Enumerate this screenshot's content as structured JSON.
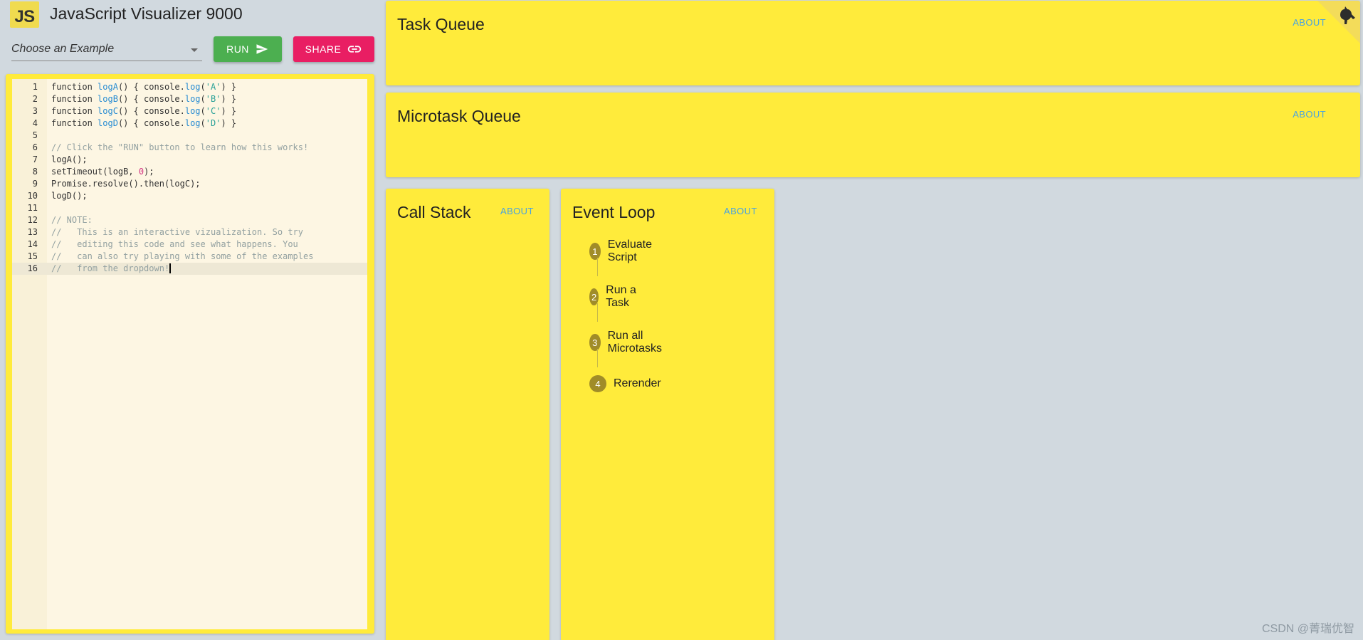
{
  "header": {
    "logo_text": "JS",
    "app_title": "JavaScript Visualizer 9000",
    "example_select_placeholder": "Choose an Example",
    "run_label": "RUN",
    "share_label": "SHARE"
  },
  "editor": {
    "lines": [
      {
        "n": "1",
        "html_tokens": [
          [
            "",
            "function "
          ],
          [
            "fn",
            "logA"
          ],
          [
            "",
            "() { console."
          ],
          [
            "fn",
            "log"
          ],
          [
            "",
            "("
          ],
          [
            "str",
            "'A'"
          ],
          [
            "",
            ") }"
          ]
        ]
      },
      {
        "n": "2",
        "html_tokens": [
          [
            "",
            "function "
          ],
          [
            "fn",
            "logB"
          ],
          [
            "",
            "() { console."
          ],
          [
            "fn",
            "log"
          ],
          [
            "",
            "("
          ],
          [
            "str",
            "'B'"
          ],
          [
            "",
            ") }"
          ]
        ]
      },
      {
        "n": "3",
        "html_tokens": [
          [
            "",
            "function "
          ],
          [
            "fn",
            "logC"
          ],
          [
            "",
            "() { console."
          ],
          [
            "fn",
            "log"
          ],
          [
            "",
            "("
          ],
          [
            "str",
            "'C'"
          ],
          [
            "",
            ") }"
          ]
        ]
      },
      {
        "n": "4",
        "html_tokens": [
          [
            "",
            "function "
          ],
          [
            "fn",
            "logD"
          ],
          [
            "",
            "() { console."
          ],
          [
            "fn",
            "log"
          ],
          [
            "",
            "("
          ],
          [
            "str",
            "'D'"
          ],
          [
            "",
            ") }"
          ]
        ]
      },
      {
        "n": "5",
        "html_tokens": []
      },
      {
        "n": "6",
        "html_tokens": [
          [
            "cm",
            "// Click the \"RUN\" button to learn how this works!"
          ]
        ]
      },
      {
        "n": "7",
        "html_tokens": [
          [
            "",
            "logA();"
          ]
        ]
      },
      {
        "n": "8",
        "html_tokens": [
          [
            "",
            "setTimeout(logB, "
          ],
          [
            "num",
            "0"
          ],
          [
            "",
            ");"
          ]
        ]
      },
      {
        "n": "9",
        "html_tokens": [
          [
            "",
            "Promise.resolve().then(logC);"
          ]
        ]
      },
      {
        "n": "10",
        "html_tokens": [
          [
            "",
            "logD();"
          ]
        ]
      },
      {
        "n": "11",
        "html_tokens": []
      },
      {
        "n": "12",
        "html_tokens": [
          [
            "cm",
            "// NOTE:"
          ]
        ]
      },
      {
        "n": "13",
        "html_tokens": [
          [
            "cm",
            "//   This is an interactive vizualization. So try"
          ]
        ]
      },
      {
        "n": "14",
        "html_tokens": [
          [
            "cm",
            "//   editing this code and see what happens. You"
          ]
        ]
      },
      {
        "n": "15",
        "html_tokens": [
          [
            "cm",
            "//   can also try playing with some of the examples"
          ]
        ]
      },
      {
        "n": "16",
        "html_tokens": [
          [
            "cm",
            "//   from the dropdown!"
          ]
        ],
        "active": true
      }
    ]
  },
  "panels": {
    "task_queue": {
      "title": "Task Queue",
      "about": "ABOUT"
    },
    "microtask_queue": {
      "title": "Microtask Queue",
      "about": "ABOUT"
    },
    "call_stack": {
      "title": "Call Stack",
      "about": "ABOUT"
    },
    "event_loop": {
      "title": "Event Loop",
      "about": "ABOUT",
      "steps": [
        {
          "num": "1",
          "label": "Evaluate Script"
        },
        {
          "num": "2",
          "label": "Run a Task"
        },
        {
          "num": "3",
          "label": "Run all Microtasks"
        },
        {
          "num": "4",
          "label": "Rerender"
        }
      ]
    }
  },
  "watermark": "CSDN @菁瑞优智",
  "colors": {
    "card_yellow": "#ffeb3b",
    "run_green": "#4caf50",
    "share_pink": "#e91e63",
    "about_blue": "#4aa3df",
    "step_badge": "#a08c28",
    "background": "#d1d9df"
  },
  "icons": [
    "send-icon",
    "link-icon",
    "github-octocat-icon",
    "chevron-down-icon"
  ]
}
